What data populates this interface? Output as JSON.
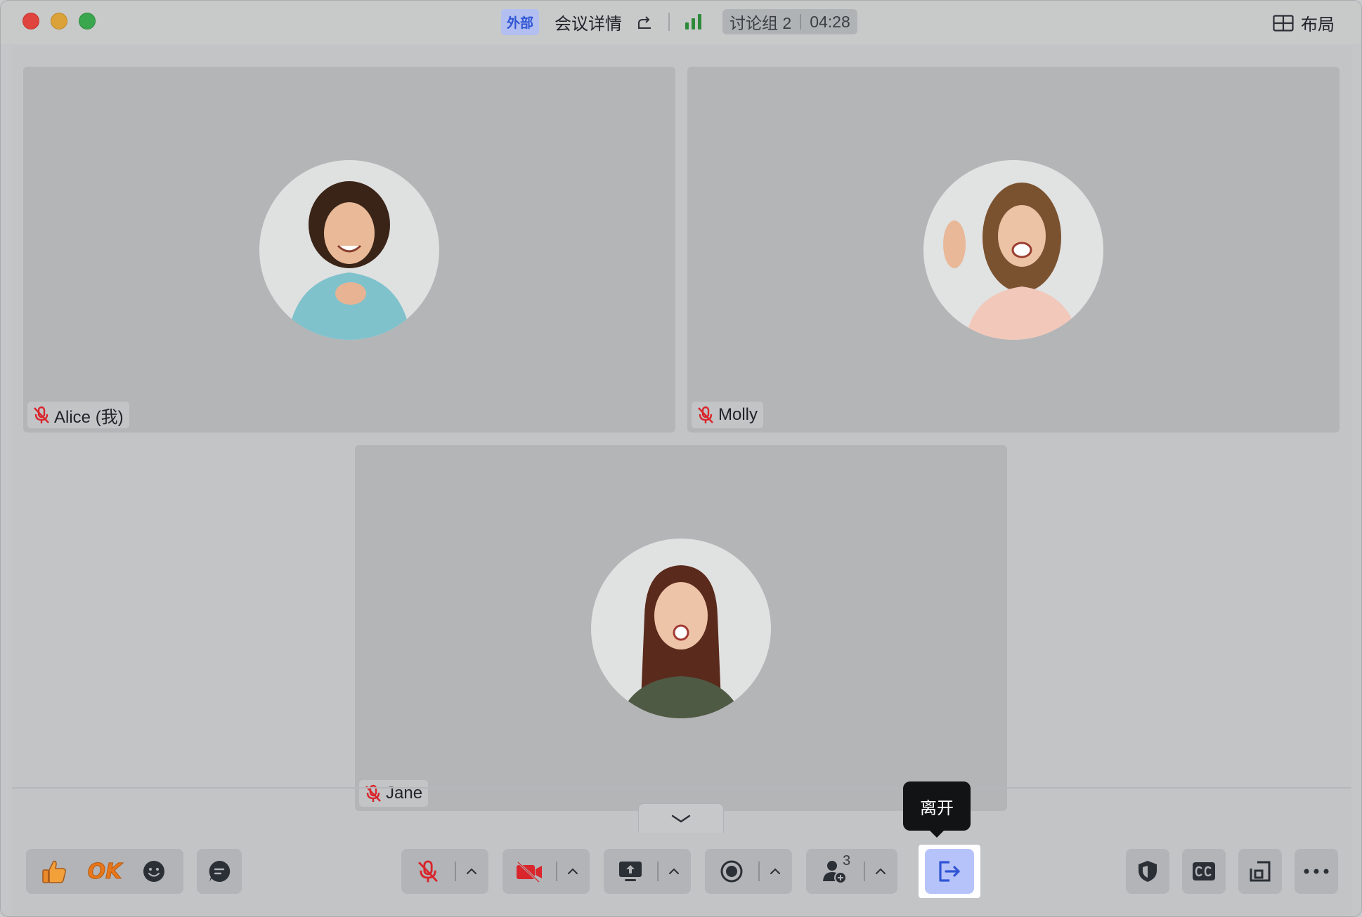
{
  "titlebar": {
    "external_tag": "外部",
    "meeting_details": "会议详情",
    "breakout_room": "讨论组 2",
    "timer": "04:28",
    "layout_label": "布局"
  },
  "participants": [
    {
      "name": "Alice (我)",
      "muted": true
    },
    {
      "name": "Molly",
      "muted": true
    },
    {
      "name": "Jane",
      "muted": true
    }
  ],
  "toolbar": {
    "reaction_ok": "OK",
    "participants_count": "3",
    "leave_tooltip": "离开"
  },
  "colors": {
    "accent": "#2f55d4",
    "leave_bg": "#b6c3fa",
    "mute_red": "#d9252b",
    "signal_green": "#2d8a3a",
    "tooltip_bg": "#121314"
  },
  "icons": [
    "thumbs-up-icon",
    "emoji-icon",
    "chat-icon",
    "mic-off-icon",
    "camera-off-icon",
    "share-screen-icon",
    "record-icon",
    "add-participant-icon",
    "leave-icon",
    "security-icon",
    "captions-icon",
    "pip-icon",
    "more-icon",
    "layout-icon",
    "share-icon",
    "signal-icon",
    "chevron-down-icon",
    "chevron-up-icon"
  ]
}
